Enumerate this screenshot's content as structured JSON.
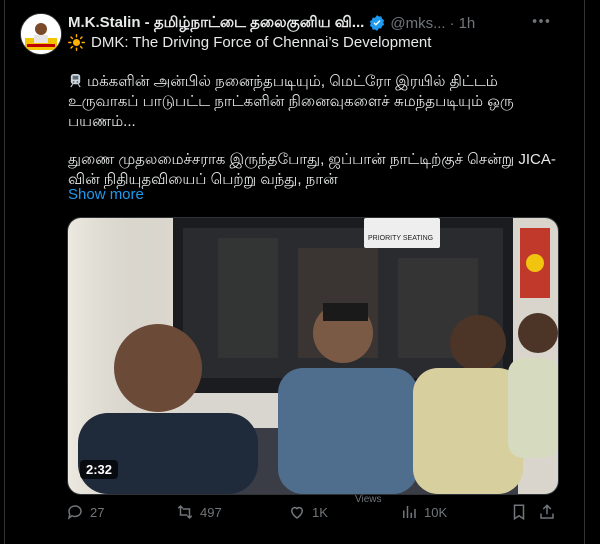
{
  "post": {
    "author_name": "M.K.Stalin - தமிழ்நாட்டை தலைகுனிய வி...",
    "handle": "@mks...",
    "dot": "·",
    "time": "1h",
    "subtitle": "DMK: The Driving Force of Chennai’s Development",
    "paragraph1": "மக்களின் அன்பில் நனைந்தபடியும், மெட்ரோ இரயில் திட்டம் உருவாகப் பாடுபட்ட நாட்களின் நினைவுகளைச் சுமந்தபடியும் ஒரு பயணம்...",
    "paragraph2": "துணை முதலமைச்சராக இருந்தபோது, ஜப்பான் நாட்டிற்குச் சென்று JICA-வின் நிதியுதவியைப் பெற்று வந்து, நான்",
    "show_more": "Show more"
  },
  "media": {
    "duration": "2:32",
    "sign_text": "PRIORITY SEATING"
  },
  "actions": {
    "replies": "27",
    "reposts": "497",
    "likes": "1K",
    "views": "10K",
    "views_label": "Views"
  },
  "colors": {
    "accent": "#1d9bf0",
    "muted": "#71767b",
    "text": "#e7e9ea",
    "background": "#000000"
  },
  "icons": [
    "verified-badge-icon",
    "more-icon",
    "sun-icon",
    "reply-icon",
    "repost-icon",
    "like-icon",
    "views-icon",
    "bookmark-icon",
    "share-icon"
  ]
}
